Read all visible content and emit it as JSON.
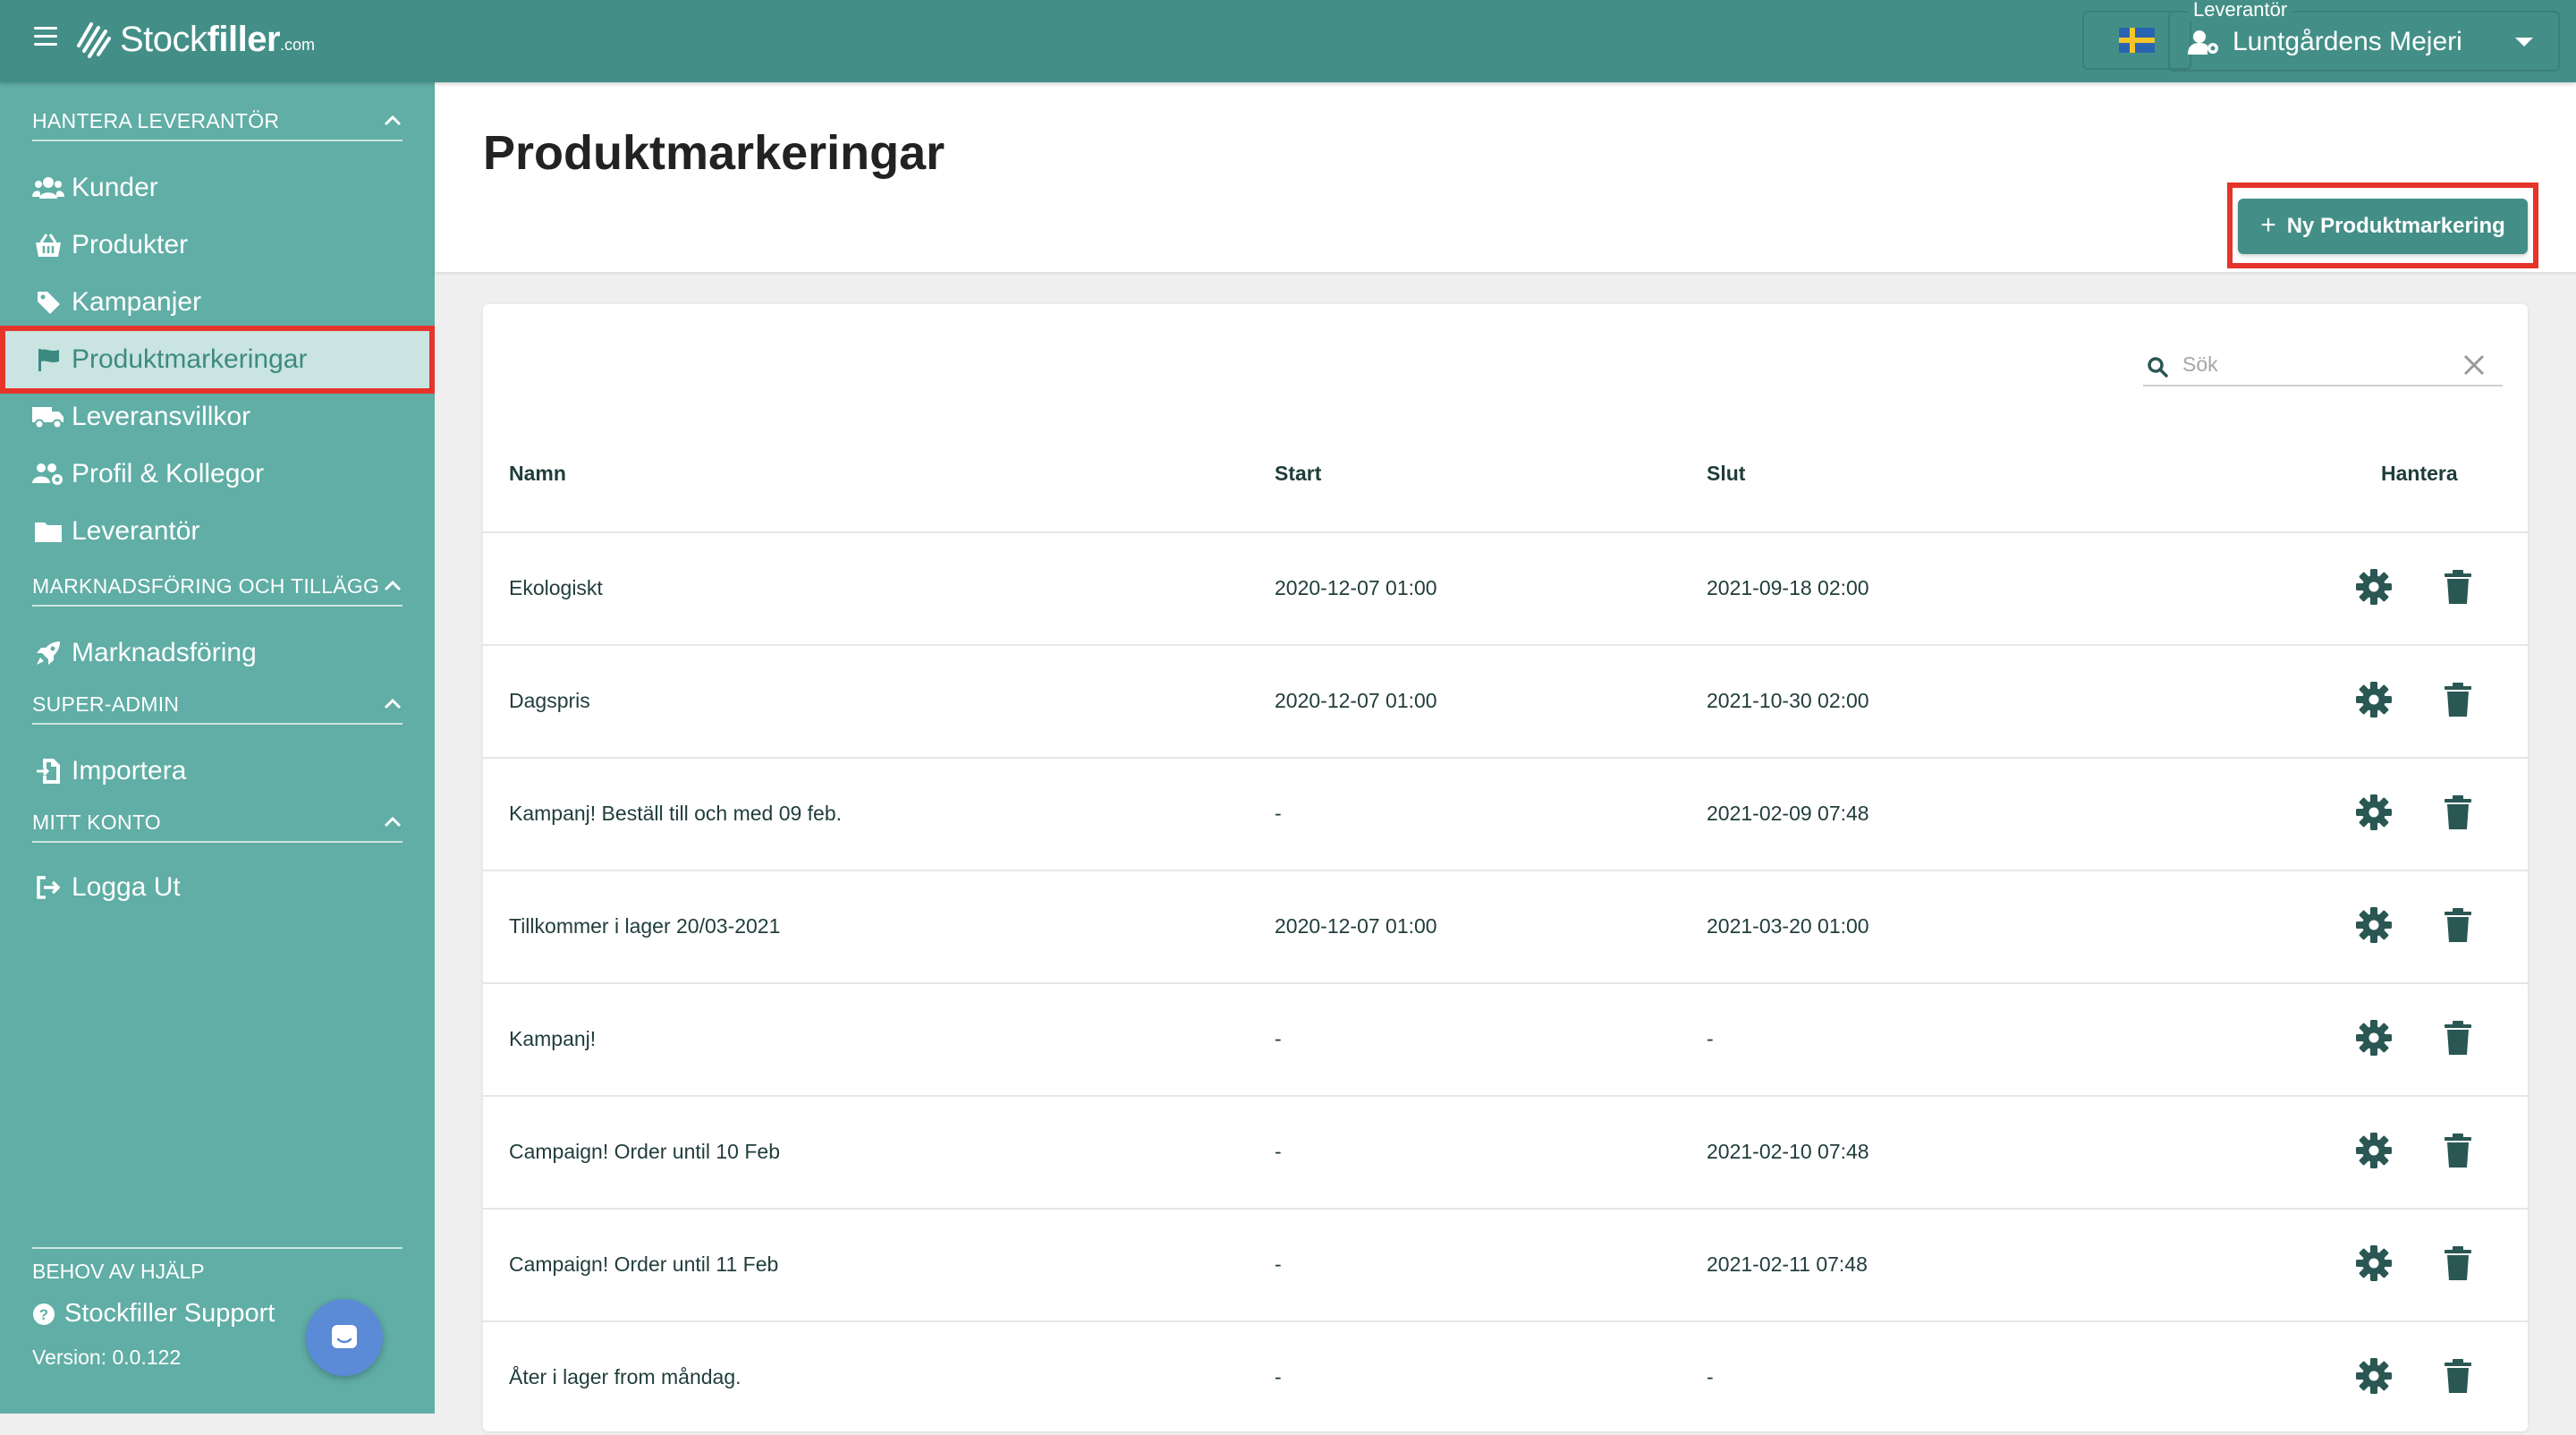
{
  "topbar": {
    "logo_text": "Stockfiller",
    "logo_bold": "filler",
    "logo_regular": "Stock",
    "logo_suffix": ".com",
    "supplier_label": "Leverantör",
    "supplier_value": "Luntgårdens Mejeri"
  },
  "sidebar": {
    "sections": [
      {
        "title": "HANTERA LEVERANTÖR"
      },
      {
        "title": "MARKNADSFÖRING OCH TILLÄGG"
      },
      {
        "title": "SUPER-ADMIN"
      },
      {
        "title": "MITT KONTO"
      }
    ],
    "items": [
      {
        "label": "Kunder",
        "icon": "users-icon"
      },
      {
        "label": "Produkter",
        "icon": "basket-icon"
      },
      {
        "label": "Kampanjer",
        "icon": "tag-icon"
      },
      {
        "label": "Produktmarkeringar",
        "icon": "flag-icon",
        "active": true
      },
      {
        "label": "Leveransvillkor",
        "icon": "truck-icon"
      },
      {
        "label": "Profil & Kollegor",
        "icon": "users-cog-icon"
      },
      {
        "label": "Leverantör",
        "icon": "folder-icon"
      },
      {
        "label": "Marknadsföring",
        "icon": "rocket-icon"
      },
      {
        "label": "Importera",
        "icon": "file-import-icon"
      },
      {
        "label": "Logga Ut",
        "icon": "sign-out-icon"
      }
    ],
    "help_title": "BEHOV AV HJÄLP",
    "support_label": "Stockfiller Support",
    "version": "Version: 0.0.122"
  },
  "page": {
    "title": "Produktmarkeringar",
    "new_button": "Ny Produktmarkering"
  },
  "search": {
    "placeholder": "Sök",
    "value": ""
  },
  "table": {
    "columns": [
      "Namn",
      "Start",
      "Slut",
      "Hantera"
    ],
    "rows": [
      {
        "name": "Ekologiskt",
        "start": "2020-12-07 01:00",
        "end": "2021-09-18 02:00"
      },
      {
        "name": "Dagspris",
        "start": "2020-12-07 01:00",
        "end": "2021-10-30 02:00"
      },
      {
        "name": "Kampanj! Beställ till och med 09 feb.",
        "start": "-",
        "end": "2021-02-09 07:48"
      },
      {
        "name": "Tillkommer i lager 20/03-2021",
        "start": "2020-12-07 01:00",
        "end": "2021-03-20 01:00"
      },
      {
        "name": "Kampanj!",
        "start": "-",
        "end": "-"
      },
      {
        "name": "Campaign! Order until 10 Feb",
        "start": "-",
        "end": "2021-02-10 07:48"
      },
      {
        "name": "Campaign! Order until 11 Feb",
        "start": "-",
        "end": "2021-02-11 07:48"
      },
      {
        "name": "Åter i lager from måndag.",
        "start": "-",
        "end": "-"
      }
    ]
  },
  "colors": {
    "topbar": "#438f87",
    "sidebar": "#60aea6",
    "active_item": "#c9e4e1",
    "highlight": "#e5342a",
    "icon_dark": "#2a5753"
  }
}
